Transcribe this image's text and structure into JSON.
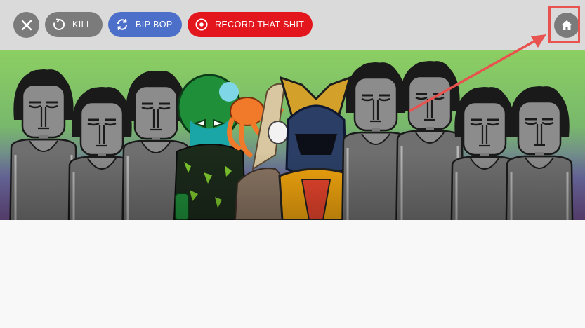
{
  "toolbar": {
    "close_icon": "close-icon",
    "kill": {
      "label": "KILL",
      "icon": "refresh-icon",
      "color": "#7b7b7b"
    },
    "bipbop": {
      "label": "BIP BOP",
      "icon": "shuffle-icon",
      "color": "#4c6fc9"
    },
    "record": {
      "label": "RECORD THAT SHIT",
      "icon": "record-icon",
      "color": "#e3151d"
    },
    "home_icon": "home-icon"
  },
  "annotation": {
    "color": "#e8524f"
  }
}
